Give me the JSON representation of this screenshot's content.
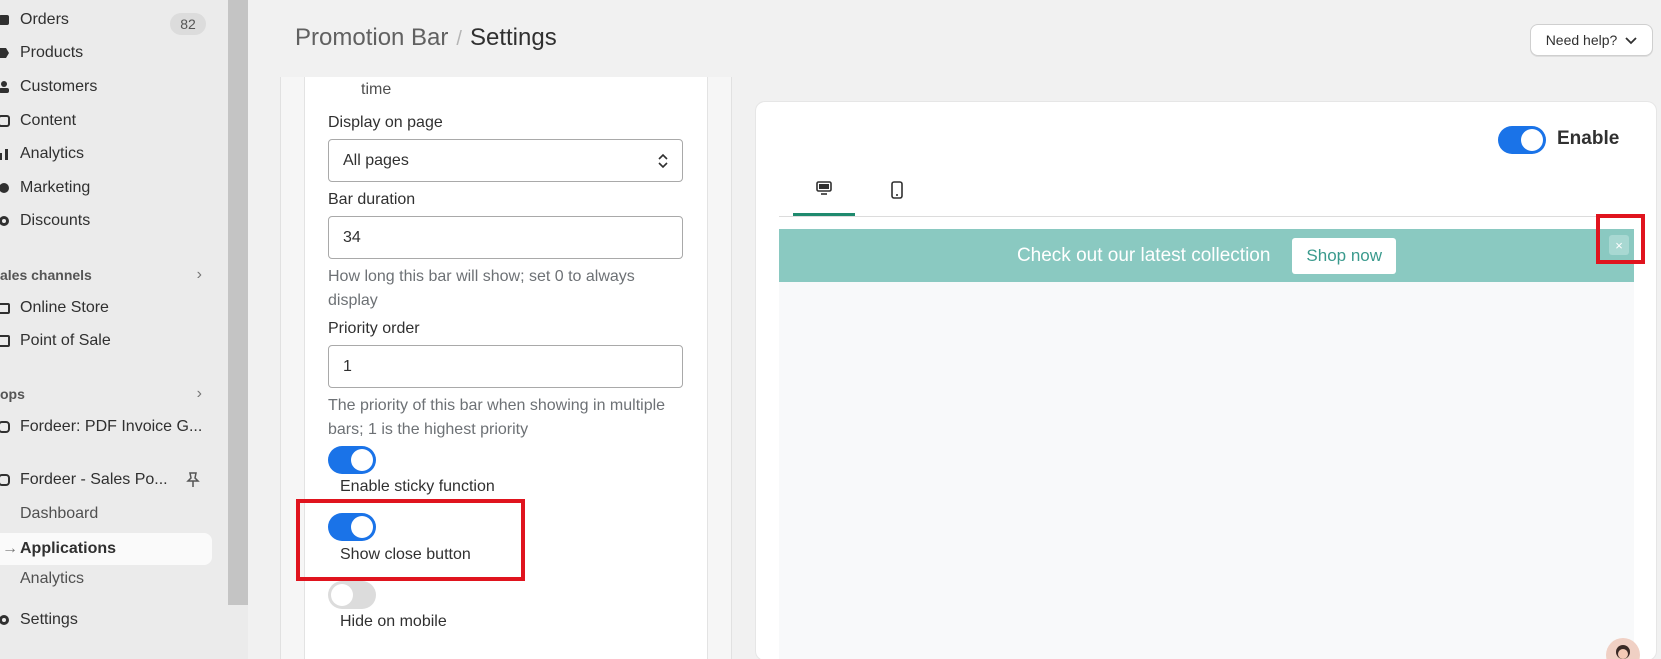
{
  "sidebar": {
    "items": [
      {
        "label": "Orders",
        "badge": "82",
        "icon": "inbox-icon"
      },
      {
        "label": "Products",
        "icon": "tag-icon"
      },
      {
        "label": "Customers",
        "icon": "person-icon"
      },
      {
        "label": "Content",
        "icon": "content-icon"
      },
      {
        "label": "Analytics",
        "icon": "bar-chart-icon"
      },
      {
        "label": "Marketing",
        "icon": "target-icon"
      },
      {
        "label": "Discounts",
        "icon": "discount-icon"
      }
    ],
    "sales_channels_header": "ales channels",
    "channels": [
      {
        "label": "Online Store",
        "icon": "store-icon"
      },
      {
        "label": "Point of Sale",
        "icon": "pos-icon"
      }
    ],
    "apps_header": "ops",
    "apps": [
      {
        "label": "Fordeer: PDF Invoice G...",
        "icon": "app-icon"
      },
      {
        "label": "Fordeer - Sales Po...",
        "icon": "app-icon"
      }
    ],
    "app_sub": [
      {
        "label": "Dashboard"
      },
      {
        "label": "Applications"
      },
      {
        "label": "Analytics"
      }
    ],
    "settings": "Settings"
  },
  "header": {
    "crumb_parent": "Promotion Bar",
    "crumb_sep": "/",
    "crumb_current": "Settings",
    "help_button": "Need help?"
  },
  "form": {
    "time_text": "time",
    "display_label": "Display on page",
    "display_value": "All pages",
    "duration_label": "Bar duration",
    "duration_value": "34",
    "duration_help": "How long this bar will show; set 0 to always display",
    "priority_label": "Priority order",
    "priority_value": "1",
    "priority_help": "The priority of this bar when showing in multiple bars; 1 is the highest priority",
    "toggles": [
      {
        "label": "Enable sticky function",
        "on": true
      },
      {
        "label": "Show close button",
        "on": true
      },
      {
        "label": "Hide on mobile",
        "on": false
      }
    ]
  },
  "preview": {
    "enable_label": "Enable",
    "enable_on": true,
    "promo_message": "Check out our latest collection",
    "shop_button": "Shop now",
    "close_glyph": "×",
    "bar_color": "#8ac9c1",
    "accent_color": "#1a73e8"
  }
}
